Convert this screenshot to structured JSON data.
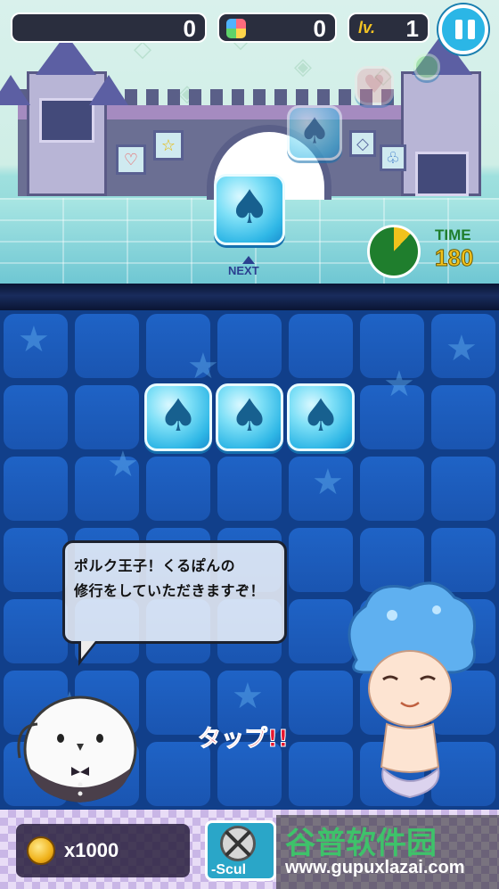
{
  "hud": {
    "score": "0",
    "color_count": "0",
    "level_label": "lv.",
    "level_value": "1"
  },
  "timer": {
    "label": "TIME",
    "value": "180",
    "remaining_fraction": 0.88
  },
  "next": {
    "label": "NEXT",
    "piece_icon": "spade-icon"
  },
  "speech": {
    "lines": [
      "ポルク王子！くるぽんの",
      "修行をしていただきますぞ！"
    ]
  },
  "tap_prompt": "タップ!!",
  "bottom": {
    "coins": "x1000",
    "skill_label": "-Scul"
  },
  "watermark": {
    "title": "谷普软件园",
    "url": "www.gupuxlazai.com"
  },
  "colors": {
    "accent": "#2bb6e6",
    "board": "#113f8a",
    "tap_red": "#e8162e",
    "time_green": "#1f7e2d",
    "time_yellow": "#f1c21c"
  }
}
